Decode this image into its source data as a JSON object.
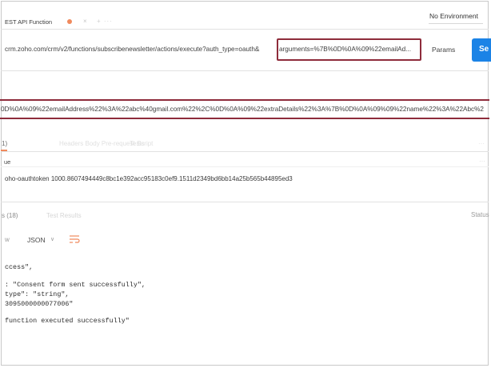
{
  "tab": {
    "title": "EST API Function",
    "close_glyph": "×",
    "plus_glyph": "+ ···",
    "status_dot_color": "#f08a5d"
  },
  "environment": {
    "label": "No Environment"
  },
  "request": {
    "url_prefix": "crm.zoho.com/crm/v2/functions/subscribenewsletter/actions/execute?auth_type=oauth&",
    "url_arguments": "arguments=%7B%0D%0A%09%22emailAd...",
    "params_label": "Params",
    "send_label": "Se",
    "send_color": "#1b83e6",
    "highlight_color": "#8e2c3b",
    "expanded_arguments": "0D%0A%09%22emailAddress%22%3A%22abc%40gmail.com%22%2C%0D%0A%09%22extraDetails%22%3A%7B%0D%0A%09%09%22name%22%3A%22Abc%2"
  },
  "subtabs": {
    "active_label": "1)",
    "faint_1": "Headers  Body  Pre-request Script",
    "faint_2": "Tests",
    "faint_right": "···"
  },
  "headers_table": {
    "key_column": "ue",
    "right_dots": "···",
    "token_value": "oho-oauthtoken 1000.8607494449c8bc1e392acc95183c0ef9.1511d2349bd6bb14a25b565b44895ed3"
  },
  "response": {
    "tab_label": "s (18)",
    "tab_faint": "Test Results",
    "status_label": "Status",
    "view_mode": "w",
    "format": "JSON",
    "format_chevron": "∨",
    "wrap_icon": "wrap-lines-icon",
    "body_lines": [
      "ccess\",",
      "",
      ": \"Consent form sent successfully\",",
      "type\": \"string\",",
      "3095000000077006\"",
      "",
      "function executed successfully\""
    ]
  }
}
